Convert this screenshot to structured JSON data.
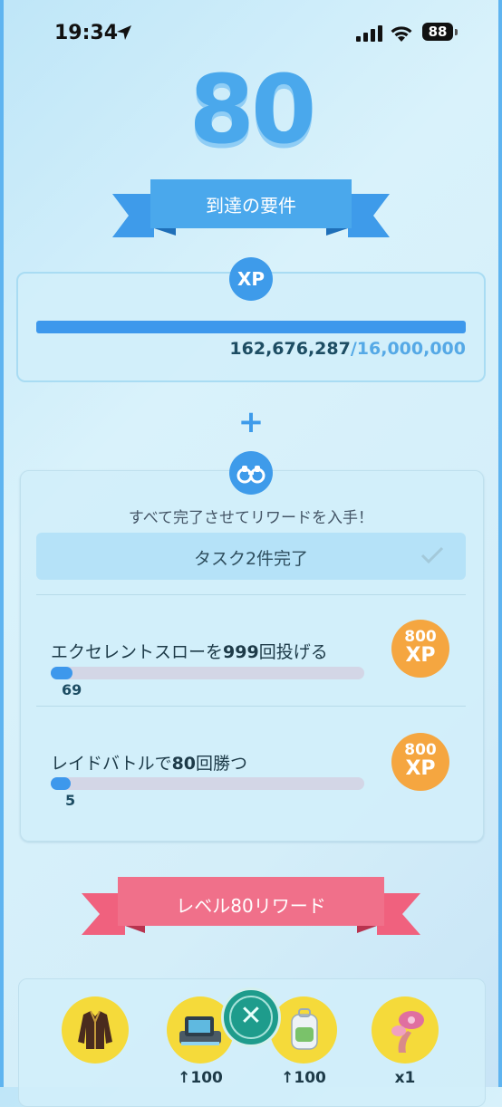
{
  "status_bar": {
    "time": "19:34",
    "battery": "88"
  },
  "level": {
    "number": "80"
  },
  "requirements": {
    "title": "到達の要件",
    "xp_badge": "XP",
    "xp_current": "162,676,287",
    "xp_separator": "/",
    "xp_required": "16,000,000",
    "xp_progress_fraction": 1.0
  },
  "plus_sign": "+",
  "tasks": {
    "subtitle": "すべて完了させてリワードを入手！",
    "completed_label": "タスク2件完了",
    "items": [
      {
        "title_before": "エクセレントスローを",
        "title_bold": "999",
        "title_after": "回投げる",
        "progress": "69",
        "progress_fraction": 0.069,
        "reward_amount": "800",
        "reward_unit": "XP"
      },
      {
        "title_before": "レイドバトルで",
        "title_bold": "80",
        "title_after": "回勝つ",
        "progress": "5",
        "progress_fraction": 0.0625,
        "reward_amount": "800",
        "reward_unit": "XP"
      }
    ]
  },
  "rewards": {
    "title": "レベル80リワード",
    "items": [
      {
        "icon": "jacket-icon",
        "label": ""
      },
      {
        "icon": "item-storage-upgrade-icon",
        "label": "↑100"
      },
      {
        "icon": "bag-upgrade-icon",
        "label": "↑100"
      },
      {
        "icon": "mushroom-lure-icon",
        "label": "x1"
      }
    ]
  },
  "colors": {
    "accent": "#3e9bea",
    "reward_ribbon": "#f0617e",
    "xp_orange": "#f5a640",
    "item_yellow": "#f5da3a",
    "close_teal": "#1e9c8c"
  }
}
